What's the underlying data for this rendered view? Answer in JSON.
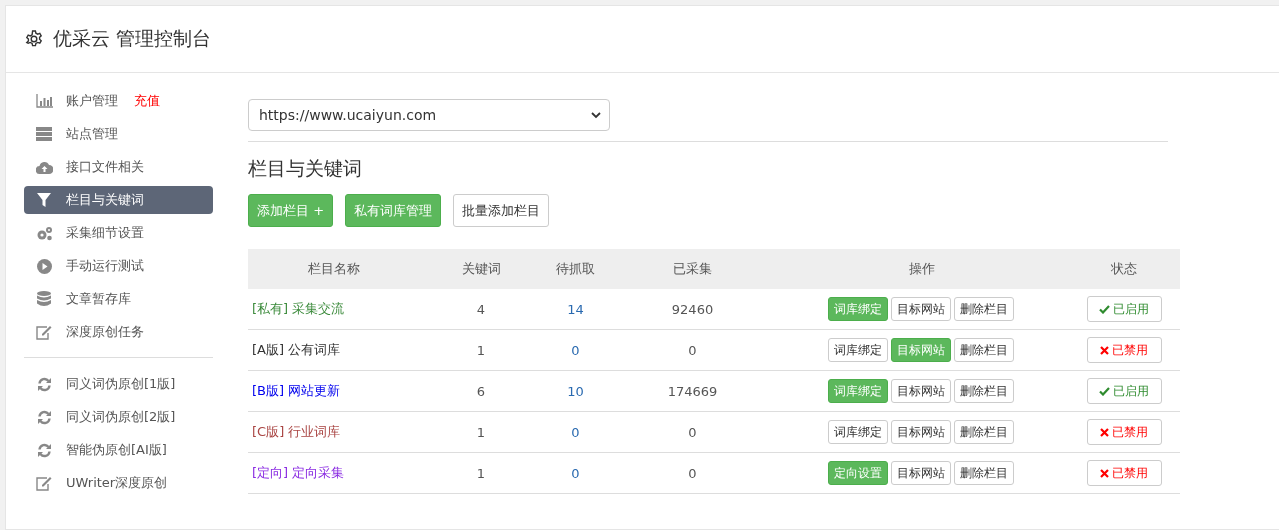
{
  "header": {
    "title": "优采云 管理控制台"
  },
  "sidebar": {
    "items": [
      {
        "label": "账户管理",
        "badge": "充值",
        "selected": false
      },
      {
        "label": "站点管理",
        "selected": false
      },
      {
        "label": "接口文件相关",
        "selected": false
      },
      {
        "label": "栏目与关键词",
        "selected": true
      },
      {
        "label": "采集细节设置",
        "selected": false
      },
      {
        "label": "手动运行测试",
        "selected": false
      },
      {
        "label": "文章暂存库",
        "selected": false
      },
      {
        "label": "深度原创任务",
        "selected": false
      },
      {
        "label": "同义词伪原创[1版]",
        "selected": false
      },
      {
        "label": "同义词伪原创[2版]",
        "selected": false
      },
      {
        "label": "智能伪原创[AI版]",
        "selected": false
      },
      {
        "label": "UWriter深度原创",
        "selected": false
      }
    ]
  },
  "site_select": {
    "value": "https://www.ucaiyun.com"
  },
  "section_title": "栏目与关键词",
  "toolbar": [
    {
      "label": "添加栏目 +",
      "kind": "primary"
    },
    {
      "label": "私有词库管理",
      "kind": "primary"
    },
    {
      "label": "批量添加栏目",
      "kind": "default"
    }
  ],
  "table": {
    "columns": [
      "栏目名称",
      "关键词",
      "待抓取",
      "已采集",
      "操作",
      "状态"
    ],
    "rows": [
      {
        "tag": "[私有]",
        "name": "采集交流",
        "color": "#3c8b3c",
        "count": "4",
        "pending": "14",
        "collected": "92460",
        "actions": [
          {
            "label": "词库绑定",
            "kind": "primary"
          },
          {
            "label": "目标网站",
            "kind": "default"
          },
          {
            "label": "删除栏目",
            "kind": "default"
          }
        ],
        "status": "已启用",
        "enabled": true
      },
      {
        "tag": "[A版]",
        "name": "公有词库",
        "color": "#333333",
        "count": "1",
        "pending": "0",
        "collected": "0",
        "actions": [
          {
            "label": "词库绑定",
            "kind": "default"
          },
          {
            "label": "目标网站",
            "kind": "primary"
          },
          {
            "label": "删除栏目",
            "kind": "default"
          }
        ],
        "status": "已禁用",
        "enabled": false
      },
      {
        "tag": "[B版]",
        "name": "网站更新",
        "color": "#0000ee",
        "count": "6",
        "pending": "10",
        "collected": "174669",
        "actions": [
          {
            "label": "词库绑定",
            "kind": "primary"
          },
          {
            "label": "目标网站",
            "kind": "default"
          },
          {
            "label": "删除栏目",
            "kind": "default"
          }
        ],
        "status": "已启用",
        "enabled": true
      },
      {
        "tag": "[C版]",
        "name": "行业词库",
        "color": "#a94442",
        "count": "1",
        "pending": "0",
        "collected": "0",
        "actions": [
          {
            "label": "词库绑定",
            "kind": "default"
          },
          {
            "label": "目标网站",
            "kind": "default"
          },
          {
            "label": "删除栏目",
            "kind": "default"
          }
        ],
        "status": "已禁用",
        "enabled": false
      },
      {
        "tag": "[定向]",
        "name": "定向采集",
        "color": "#8a2be2",
        "count": "1",
        "pending": "0",
        "collected": "0",
        "actions": [
          {
            "label": "定向设置",
            "kind": "primary"
          },
          {
            "label": "目标网站",
            "kind": "default"
          },
          {
            "label": "删除栏目",
            "kind": "default"
          }
        ],
        "status": "已禁用",
        "enabled": false
      }
    ]
  }
}
